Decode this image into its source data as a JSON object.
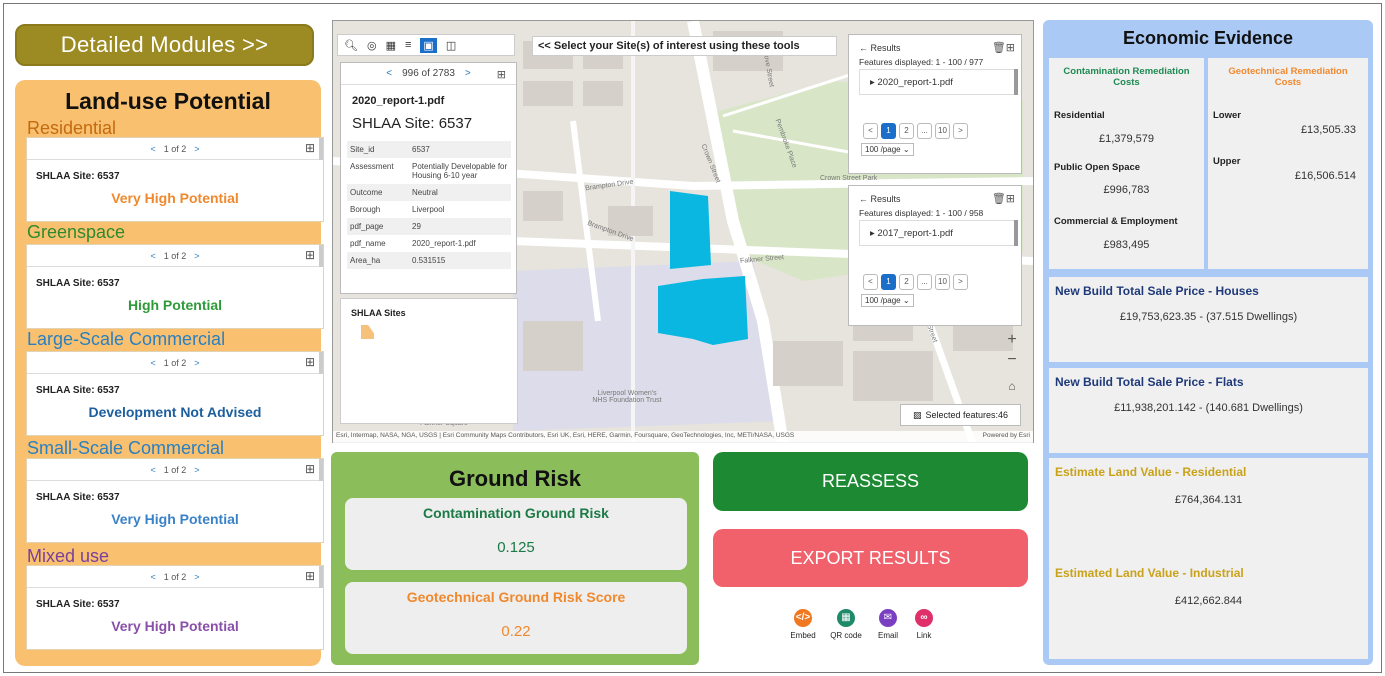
{
  "detailed_modules": {
    "label": "Detailed Modules >>"
  },
  "land_use": {
    "title": "Land-use Potential",
    "categories": [
      {
        "name": "Residential",
        "name_color": "#c46a10",
        "pager": {
          "prev": "<",
          "text": "1 of 2",
          "next": ">"
        },
        "site": "SHLAA Site: 6537",
        "potential": "Very High Potential",
        "potential_color": "#f0892e"
      },
      {
        "name": "Greenspace",
        "name_color": "#2e8a2e",
        "pager": {
          "prev": "<",
          "text": "1 of 2",
          "next": ">"
        },
        "site": "SHLAA Site: 6537",
        "potential": "High Potential",
        "potential_color": "#2e9a3a"
      },
      {
        "name": "Large-Scale Commercial",
        "name_color": "#2a7fc1",
        "pager": {
          "prev": "<",
          "text": "1 of 2",
          "next": ">"
        },
        "site": "SHLAA Site: 6537",
        "potential": "Development Not Advised",
        "potential_color": "#1c5e9e"
      },
      {
        "name": "Small-Scale Commercial",
        "name_color": "#2a7fc1",
        "pager": {
          "prev": "<",
          "text": "1 of 2",
          "next": ">"
        },
        "site": "SHLAA Site: 6537",
        "potential": "Very High Potential",
        "potential_color": "#3a82c8"
      },
      {
        "name": "Mixed use",
        "name_color": "#7a3f9c",
        "pager": {
          "prev": "<",
          "text": "1 of 2",
          "next": ">"
        },
        "site": "SHLAA Site: 6537",
        "potential": "Very High Potential",
        "potential_color": "#8a4fa8"
      }
    ]
  },
  "map": {
    "toolbar_icons": [
      "search-icon",
      "layers-icon",
      "grid-icon",
      "select-icon",
      "draw-icon"
    ],
    "select_tip": "<< Select your Site(s) of interest using these tools",
    "popup": {
      "prev": "<",
      "count": "996 of 2783",
      "next": ">",
      "file": "2020_report-1.pdf",
      "site": "SHLAA Site: 6537",
      "rows": [
        {
          "k": "Site_id",
          "v": "6537"
        },
        {
          "k": "Assessment",
          "v": "Potentially Developable for Housing 6-10 year"
        },
        {
          "k": "Outcome",
          "v": "Neutral"
        },
        {
          "k": "Borough",
          "v": "Liverpool"
        },
        {
          "k": "pdf_page",
          "v": "29"
        },
        {
          "k": "pdf_name",
          "v": "2020_report-1.pdf"
        },
        {
          "k": "Area_ha",
          "v": "0.531515"
        }
      ]
    },
    "legend_title": "SHLAA Sites",
    "results_label": "Results",
    "results": [
      {
        "count": "Features displayed: 1 - 100 / 977",
        "item": "2020_report-1.pdf",
        "pages": [
          "<",
          "1",
          "2",
          "...",
          "10",
          ">"
        ],
        "per_page": "100 /page"
      },
      {
        "count": "Features displayed: 1 - 100 / 958",
        "item": "2017_report-1.pdf",
        "pages": [
          "<",
          "1",
          "2",
          "...",
          "10",
          ">"
        ],
        "per_page": "100 /page"
      }
    ],
    "selected_features": "Selected features:46",
    "streets": [
      "Brampton Drive",
      "Brampton Drive",
      "Falkner Street",
      "Grove Street",
      "Crown Street",
      "Crown Street Park",
      "Liverpool Women's NHS Foundation Trust",
      "Pembroke Place",
      "Falkner Square",
      "Mount Street"
    ],
    "attribution": "Esri, Intermap, NASA, NGA, USGS | Esri Community Maps Contributors, Esri UK, Esri, HERE, Garmin, Foursquare, GeoTechnologies, Inc, METI/NASA, USGS",
    "powered_by": "Powered by Esri",
    "site_color": "#0ab7e0"
  },
  "ground_risk": {
    "title": "Ground Risk",
    "contamination": {
      "label": "Contamination Ground Risk",
      "value": "0.125",
      "color": "#1b7a45"
    },
    "geotechnical": {
      "label": "Geotechnical Ground Risk Score",
      "value": "0.22",
      "color": "#f0892e"
    }
  },
  "actions": {
    "reassess": "REASSESS",
    "export": "EXPORT RESULTS",
    "share": [
      {
        "label": "Embed",
        "icon": "code-icon",
        "color": "#f07820"
      },
      {
        "label": "QR code",
        "icon": "qr-code-icon",
        "color": "#1e8a6a"
      },
      {
        "label": "Email",
        "icon": "email-icon",
        "color": "#7a3fc0"
      },
      {
        "label": "Link",
        "icon": "link-icon",
        "color": "#e0306a"
      }
    ]
  },
  "economic": {
    "title": "Economic Evidence",
    "contamination_header": "Contamination Remediation Costs",
    "contamination_color": "#1e8a52",
    "geotechnical_header": "Geotechnical Remediation Costs",
    "geotechnical_color": "#f0892e",
    "contamination_items": [
      {
        "label": "Residential",
        "value": "£1,379,579"
      },
      {
        "label": "Public Open Space",
        "value": "£996,783"
      },
      {
        "label": "Commercial & Employment",
        "value": "£983,495"
      }
    ],
    "geotechnical_items": [
      {
        "label": "Lower",
        "value": "£13,505.33"
      },
      {
        "label": "Upper",
        "value": "£16,506.514"
      }
    ],
    "boxes": [
      {
        "title": "New Build Total Sale Price - Houses",
        "value": "£19,753,623.35 - (37.515 Dwellings)",
        "color": "#1f3a7a"
      },
      {
        "title": "New Build Total Sale Price - Flats",
        "value": "£11,938,201.142 - (140.681 Dwellings)",
        "color": "#1f3a7a"
      },
      {
        "title": "Estimate Land Value - Residential",
        "value": "£764,364.131",
        "color": "#c9a21a"
      },
      {
        "title": "Estimated Land Value - Industrial",
        "value": "£412,662.844",
        "color": "#c9a21a"
      }
    ]
  }
}
